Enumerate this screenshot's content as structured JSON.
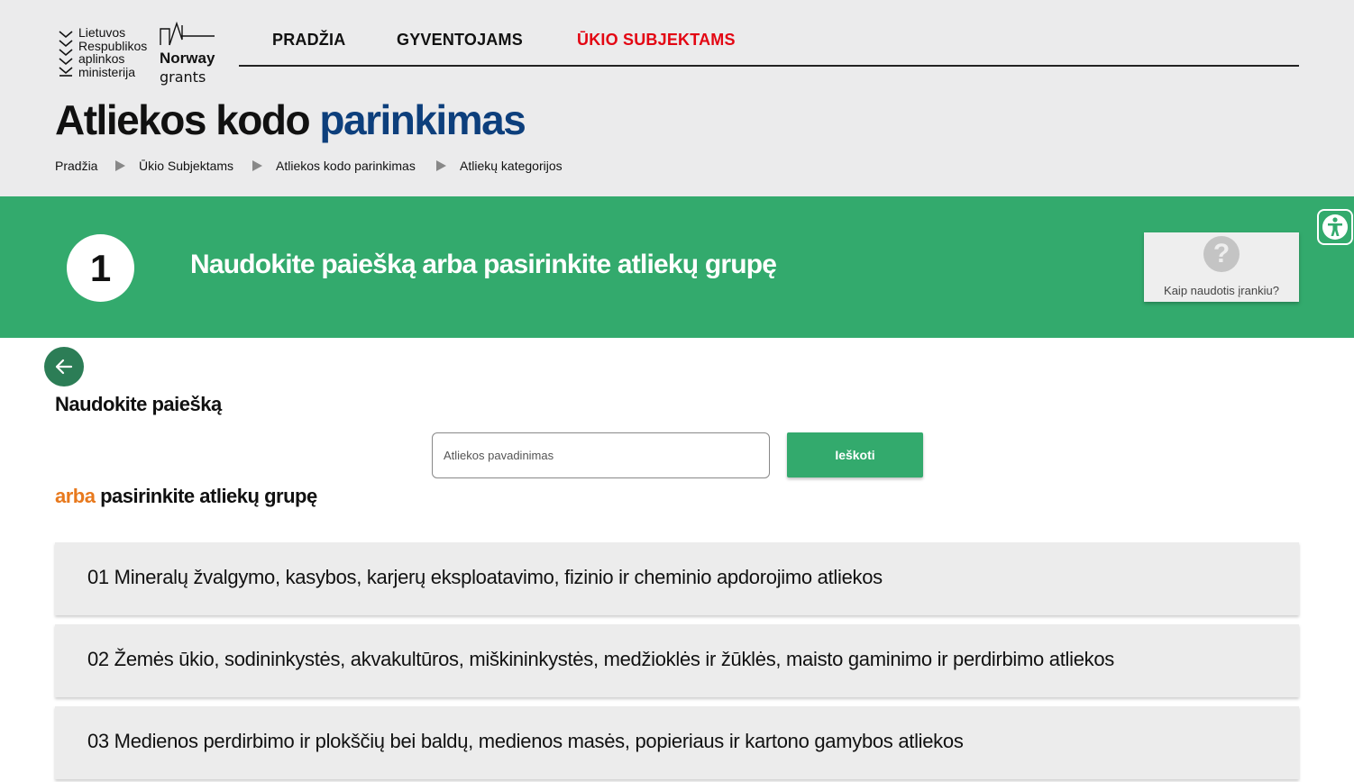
{
  "logos": {
    "ministry_lines": [
      "Lietuvos",
      "Respublikos",
      "aplinkos",
      "ministerija"
    ],
    "norway_name": "Norway",
    "norway_grants": "grants"
  },
  "nav": {
    "items": [
      {
        "label": "PRADŽIA",
        "active": false
      },
      {
        "label": "GYVENTOJAMS",
        "active": false
      },
      {
        "label": "ŪKIO SUBJEKTAMS",
        "active": true
      }
    ]
  },
  "page_title": {
    "part1": "Atliekos kodo",
    "part2": "parinkimas"
  },
  "breadcrumb": [
    "Pradžia",
    "Ūkio Subjektams",
    "Atliekos kodo parinkimas",
    "Atliekų kategorijos"
  ],
  "step": {
    "number": "1",
    "title": "Naudokite paiešką arba pasirinkite atliekų grupę",
    "help_label": "Kaip naudotis įrankiu?",
    "help_icon": "question-icon"
  },
  "search": {
    "heading": "Naudokite paiešką",
    "placeholder": "Atliekos pavadinimas",
    "value": "",
    "button_label": "Ieškoti"
  },
  "choose": {
    "or_word": "arba",
    "rest": "pasirinkite atliekų grupę"
  },
  "groups": [
    "01 Mineralų žvalgymo, kasybos, karjerų eksploatavimo, fizinio ir cheminio apdorojimo atliekos",
    "02 Žemės ūkio, sodininkystės, akvakultūros, miškininkystės, medžioklės ir žūklės, maisto gaminimo ir perdirbimo atliekos",
    "03 Medienos perdirbimo ir plokščių bei baldų, medienos masės, popieriaus ir kartono gamybos atliekos"
  ],
  "colors": {
    "accent_green": "#33aa6d",
    "dark_green": "#2c7d56",
    "nav_active_red": "#e30613",
    "title_blue": "#0d3f7c",
    "or_orange": "#e8791d",
    "header_bg": "#ebebec"
  }
}
